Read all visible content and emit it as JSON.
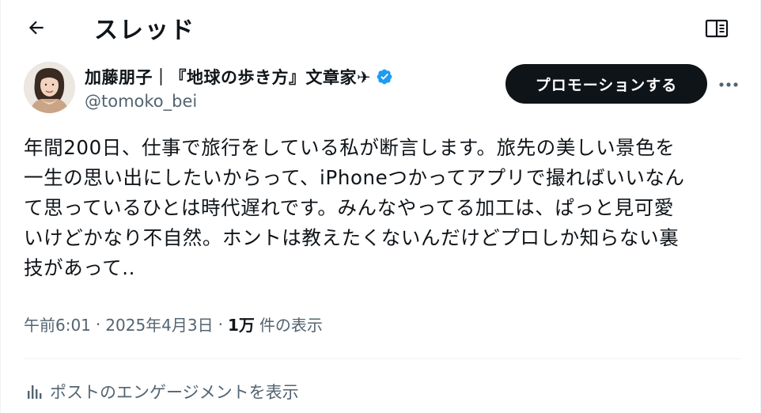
{
  "header": {
    "title": "スレッド"
  },
  "author": {
    "display_name": "加藤朋子｜『地球の歩き方』文章家✈",
    "handle": "@tomoko_bei"
  },
  "actions": {
    "promote_label": "プロモーションする"
  },
  "tweet": {
    "lines": [
      "年間200日、仕事で旅行をしている私が断言します。旅先の美しい景色を",
      "一生の思い出にしたいからって、iPhoneつかってアプリで撮ればいいなん",
      "て思っているひとは時代遅れです。みんなやってる加工は、ぱっと見可愛",
      "いけどかなり不自然。ホントは教えたくないんだけどプロしか知らない裏",
      "技があって.."
    ]
  },
  "meta": {
    "time": "午前6:01",
    "separator": "·",
    "date": "2025年4月3日",
    "views_count": "1万",
    "views_label": "件の表示"
  },
  "engagement": {
    "label": "ポストのエンゲージメントを表示"
  },
  "colors": {
    "text_primary": "#0f1419",
    "text_secondary": "#536471",
    "verified_blue": "#1d9bf0",
    "button_dark": "#0f1419",
    "divider": "#eff3f4"
  },
  "icons": {
    "back": "arrow-left-icon",
    "reader": "book-icon",
    "verified": "verified-badge-icon",
    "more": "more-dots-icon",
    "analytics": "bar-chart-icon"
  }
}
